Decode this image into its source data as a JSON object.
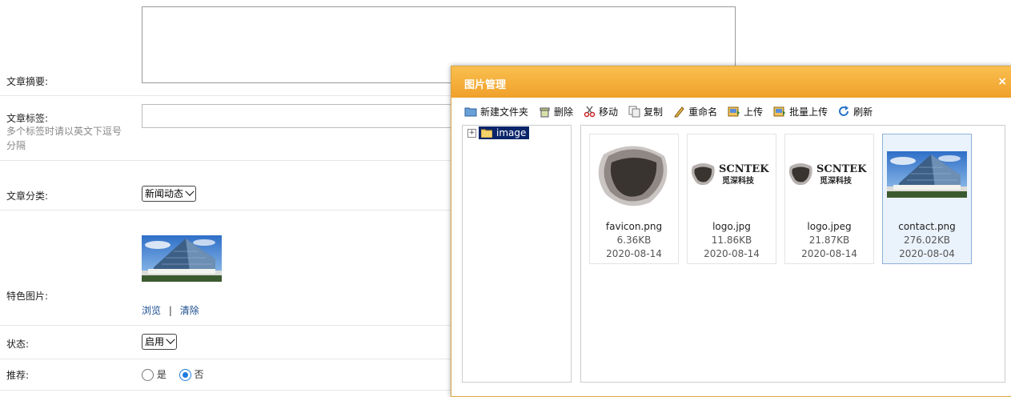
{
  "form": {
    "summary_label": "文章摘要:",
    "tags_label": "文章标签:",
    "tags_hint": "多个标签时请以英文下逗号分隔",
    "category_label": "文章分类:",
    "category_value": "新闻动态",
    "featured_label": "特色图片:",
    "browse": "浏览",
    "sep": "|",
    "clear": "清除",
    "status_label": "状态:",
    "status_value": "启用",
    "recommend_label": "推荐:",
    "yes": "是",
    "no": "否",
    "recommend_selected": "否"
  },
  "dialog": {
    "title": "图片管理",
    "close": "×",
    "toolbar": [
      {
        "label": "新建文件夹",
        "icon": "new-folder-icon"
      },
      {
        "label": "删除",
        "icon": "trash-icon"
      },
      {
        "label": "移动",
        "icon": "scissors-icon"
      },
      {
        "label": "复制",
        "icon": "copy-icon"
      },
      {
        "label": "重命名",
        "icon": "pencil-icon"
      },
      {
        "label": "上传",
        "icon": "upload-icon"
      },
      {
        "label": "批量上传",
        "icon": "batch-upload-icon"
      },
      {
        "label": "刷新",
        "icon": "refresh-icon"
      }
    ],
    "tree": {
      "expander": "+",
      "folder": "image"
    },
    "files": [
      {
        "name": "favicon.png",
        "size": "6.36KB",
        "date": "2020-08-14",
        "kind": "favicon"
      },
      {
        "name": "logo.jpg",
        "size": "11.86KB",
        "date": "2020-08-14",
        "kind": "logo"
      },
      {
        "name": "logo.jpeg",
        "size": "21.87KB",
        "date": "2020-08-14",
        "kind": "logo"
      },
      {
        "name": "contact.png",
        "size": "276.02KB",
        "date": "2020-08-04",
        "kind": "building",
        "selected": true
      }
    ],
    "logo_text": "SCNTEK",
    "logo_sub": "觅深科技"
  },
  "colors": {
    "accent": "#f0a02a",
    "link": "#1a4d8c",
    "tree_selected": "#0a246a",
    "radio": "#1e7be0"
  }
}
